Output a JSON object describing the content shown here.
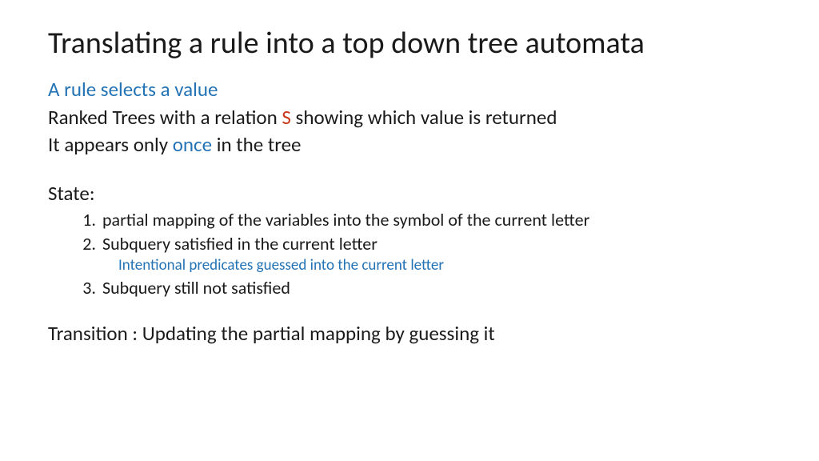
{
  "title": "Translating a rule into a top down tree automata",
  "subtitle": "A rule selects a value",
  "line1_part1": "Ranked Trees with a relation ",
  "line1_s": "S",
  "line1_part2": " showing which value is returned",
  "line2_part1": "It appears only ",
  "line2_once": "once",
  "line2_part2": " in the tree",
  "state_label": "State:",
  "list": {
    "item1_num": "1.",
    "item1": "partial mapping of the variables into the symbol of the current letter",
    "item2_num": "2.",
    "item2": "Subquery satisfied in the current letter",
    "item2_sub": "Intentional predicates guessed into the current letter",
    "item3_num": "3.",
    "item3": "Subquery still not satisfied"
  },
  "transition": "Transition : Updating the partial mapping by guessing it"
}
